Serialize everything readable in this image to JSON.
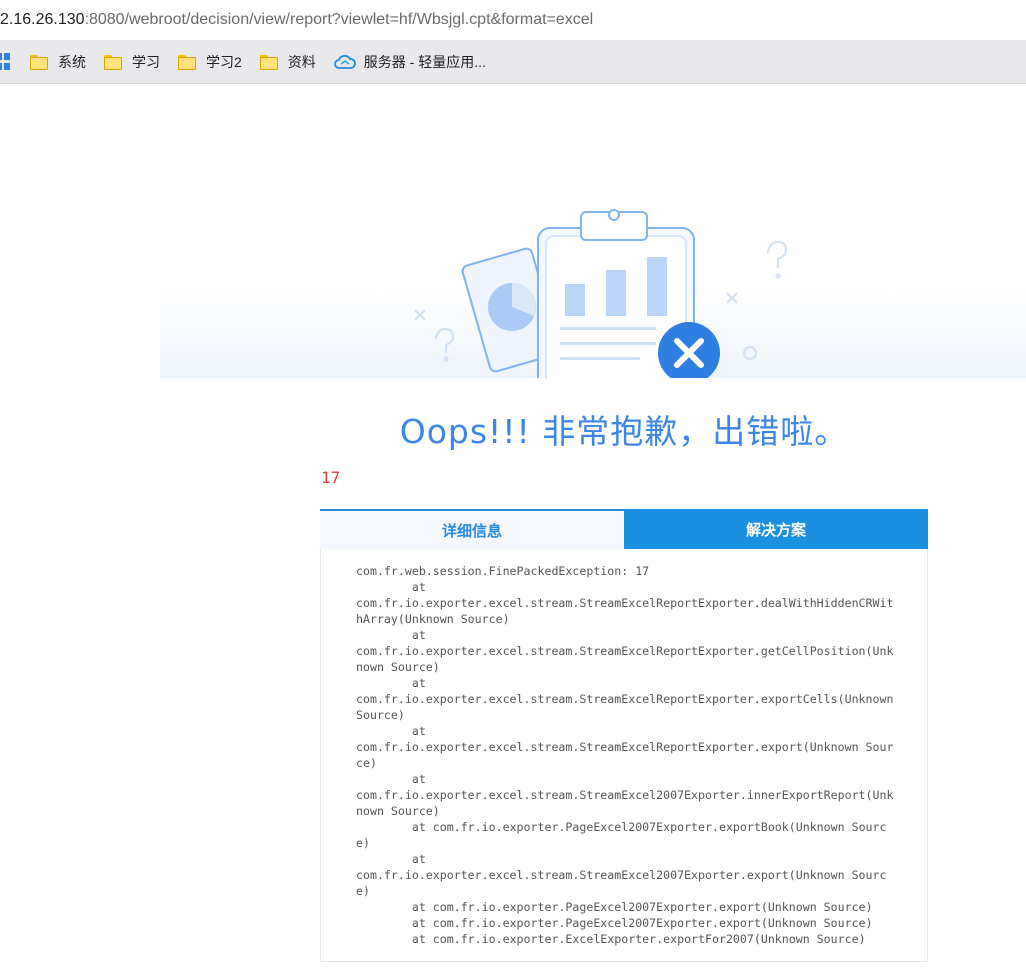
{
  "address_bar": {
    "host": "2.16.26.130",
    "path": ":8080/webroot/decision/view/report?viewlet=hf/Wbsjgl.cpt&format=excel"
  },
  "bookmarks": [
    {
      "label": "系统",
      "icon": "folder-icon"
    },
    {
      "label": "学习",
      "icon": "folder-icon"
    },
    {
      "label": "学习2",
      "icon": "folder-icon"
    },
    {
      "label": "资料",
      "icon": "folder-icon"
    },
    {
      "label": "服务器 - 轻量应用...",
      "icon": "cloud-icon"
    }
  ],
  "error": {
    "title": "Oops!!! 非常抱歉，出错啦。",
    "code": "17"
  },
  "tabs": {
    "detail": "详细信息",
    "solution": "解决方案"
  },
  "stack_trace": [
    "com.fr.web.session.FinePackedException: 17",
    "        at",
    "com.fr.io.exporter.excel.stream.StreamExcelReportExporter.dealWithHiddenCRWithArray(Unknown Source)",
    "        at",
    "com.fr.io.exporter.excel.stream.StreamExcelReportExporter.getCellPosition(Unknown Source)",
    "        at",
    "com.fr.io.exporter.excel.stream.StreamExcelReportExporter.exportCells(Unknown Source)",
    "        at",
    "com.fr.io.exporter.excel.stream.StreamExcelReportExporter.export(Unknown Source)",
    "        at",
    "com.fr.io.exporter.excel.stream.StreamExcel2007Exporter.innerExportReport(Unknown Source)",
    "        at com.fr.io.exporter.PageExcel2007Exporter.exportBook(Unknown Source)",
    "        at",
    "com.fr.io.exporter.excel.stream.StreamExcel2007Exporter.export(Unknown Source)",
    "        at com.fr.io.exporter.PageExcel2007Exporter.export(Unknown Source)",
    "        at com.fr.io.exporter.PageExcel2007Exporter.export(Unknown Source)",
    "        at com.fr.io.exporter.ExcelExporter.exportFor2007(Unknown Source)"
  ],
  "colors": {
    "accent": "#3b86e6",
    "tab_active": "#1b90e0",
    "error_code": "#e8403d"
  }
}
